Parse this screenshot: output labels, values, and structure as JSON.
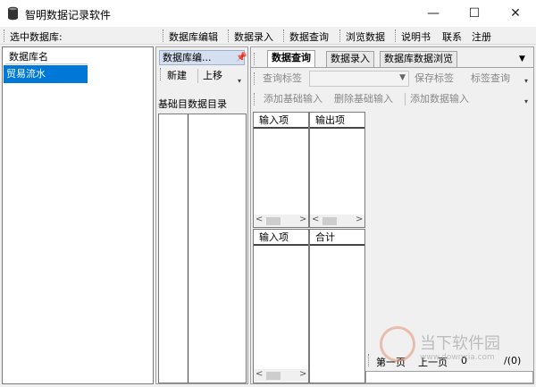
{
  "window": {
    "title": "智明数据记录软件",
    "minimize": "—",
    "maximize": "☐",
    "close": "✕"
  },
  "menubar": {
    "select_db_label": "选中数据库:",
    "items": [
      "数据库编辑",
      "数据录入",
      "数据查询",
      "浏览数据",
      "说明书",
      "联系",
      "注册"
    ]
  },
  "left_panel": {
    "header": "数据库名",
    "rows": [
      "贸易流水"
    ]
  },
  "mid_panel": {
    "tab_label": "数据库编...",
    "new_button": "新建",
    "up_button": "上移",
    "catalog_label": "基础目数据目录"
  },
  "right_panel": {
    "tabs": [
      "数据查询",
      "数据录入",
      "数据库数据浏览"
    ],
    "active_tab": 0,
    "toolbar1": {
      "query_tag": "查询标签",
      "save_tag": "保存标签",
      "tag_query": "标签查询"
    },
    "toolbar2": {
      "add_basic_input": "添加基础输入",
      "delete_basic_input": "删除基础输入",
      "add_data_input": "添加数据输入"
    },
    "grid_top": {
      "col1": "输入项",
      "col2": "输出项"
    },
    "grid_bottom": {
      "col1": "输入项",
      "col2": "合计"
    },
    "nav": {
      "first_page": "第一页",
      "prev_page": "上一页",
      "page_number": "0",
      "total_pages": "/(0)"
    }
  },
  "watermark": {
    "text": "当下软件园",
    "url": "www.downxia.com"
  }
}
